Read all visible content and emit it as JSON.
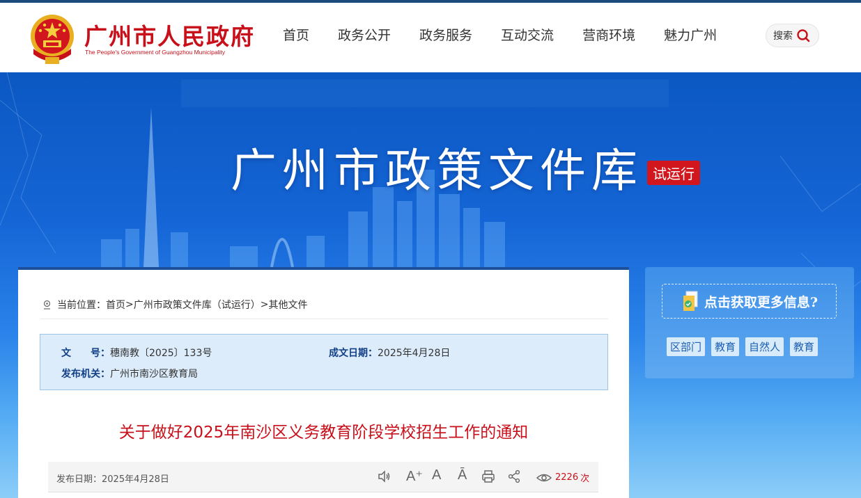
{
  "header": {
    "title": "广州市人民政府",
    "subtitle": "The People's Government of Guangzhou Municipality",
    "nav": [
      "首页",
      "政务公开",
      "政务服务",
      "互动交流",
      "营商环境",
      "魅力广州"
    ],
    "search_label": "搜索"
  },
  "banner": {
    "title": "广州市政策文件库",
    "badge": "试运行"
  },
  "breadcrumb": {
    "prefix": "当前位置：",
    "home": "首页",
    "sep1": " > ",
    "library": "广州市政策文件库（试运行）",
    "sep2": " > ",
    "current": "其他文件"
  },
  "meta": {
    "doc_no_label": "文　　号：",
    "doc_no": "穗南教〔2025〕133号",
    "date_label": "成文日期：",
    "date": "2025年4月28日",
    "issuer_label": "发布机关：",
    "issuer": "广州市南沙区教育局"
  },
  "document": {
    "title": "关于做好2025年南沙区义务教育阶段学校招生工作的通知"
  },
  "toolbar": {
    "pub_date": "发布日期：2025年4月28日",
    "font_increase": "A⁺",
    "font_normal": "A",
    "font_decrease": "Ā",
    "views": "2226",
    "views_unit": "次"
  },
  "side": {
    "more_info": "点击获取更多信息?",
    "tags": [
      "区部门",
      "教育",
      "自然人",
      "教育"
    ]
  },
  "colors": {
    "brand_red": "#c8101b",
    "nav_dark": "#1b4b7e",
    "banner_blue": "#1565d6"
  }
}
